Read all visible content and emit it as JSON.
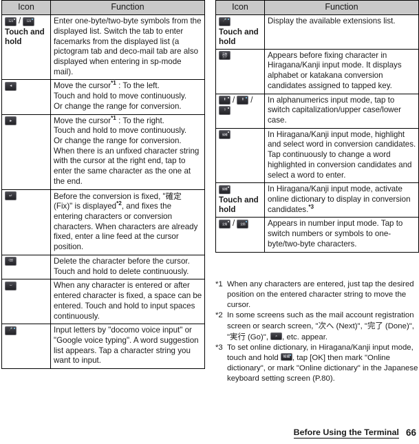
{
  "document": {
    "footer": {
      "section_title": "Before Using the Terminal",
      "page_number": "66"
    }
  },
  "left_table": {
    "headers": {
      "icon": "Icon",
      "function": "Function"
    },
    "rows": [
      {
        "icon_note": "Touch and hold",
        "icon_keys": [
          "123-one-byte-symbol-key",
          "123-two-byte-symbol-key"
        ],
        "function": "Enter one-byte/two-byte symbols from the displayed list. Switch the tab to enter facemarks from the displayed list (a pictogram tab and deco-mail tab are also displayed when entering in sp-mode mail)."
      },
      {
        "icon_note": "",
        "icon_keys": [
          "cursor-left-key"
        ],
        "function_parts": [
          {
            "text": "Move the cursor"
          },
          {
            "sup": "*1"
          },
          {
            "text": " : To the left."
          },
          {
            "br": true
          },
          {
            "text": "Touch and hold to move continuously."
          },
          {
            "br": true
          },
          {
            "text": "Or change the range for conversion."
          }
        ]
      },
      {
        "icon_note": "",
        "icon_keys": [
          "cursor-right-key"
        ],
        "function_parts": [
          {
            "text": "Move the cursor"
          },
          {
            "sup": "*1"
          },
          {
            "text": " : To the right."
          },
          {
            "br": true
          },
          {
            "text": "Touch and hold to move continuously."
          },
          {
            "br": true
          },
          {
            "text": "Or change the range for conversion."
          },
          {
            "br": true
          },
          {
            "text": "When there is an unfixed character string with the cursor at the right end, tap to enter the same character as the one at the end."
          }
        ]
      },
      {
        "icon_note": "",
        "icon_keys": [
          "enter-key"
        ],
        "function_parts": [
          {
            "text": "Before the conversion is fixed, \""
          },
          {
            "jp": "確定"
          },
          {
            "text": " (Fix)\" is displayed"
          },
          {
            "sup": "*2"
          },
          {
            "text": ", and fixes the entering characters or conversion characters. When characters are already fixed, enter a line feed at the cursor position."
          }
        ]
      },
      {
        "icon_note": "",
        "icon_keys": [
          "backspace-key"
        ],
        "function": "Delete the character before the cursor. Touch and hold to delete continuously."
      },
      {
        "icon_note": "",
        "icon_keys": [
          "space-key"
        ],
        "function": "When any character is entered or after entered character is fixed, a space can be entered. Touch and hold to input spaces continuously."
      },
      {
        "icon_note": "",
        "icon_keys": [
          "microphone-voice-input-key"
        ],
        "function": "Input letters by \"docomo voice input\" or \"Google voice typing\". A word suggestion list appears. Tap a character string you want to input."
      }
    ]
  },
  "right_table": {
    "headers": {
      "icon": "Icon",
      "function": "Function"
    },
    "rows": [
      {
        "icon_note": "Touch and hold",
        "icon_keys": [
          "microphone-voice-input-key"
        ],
        "function": "Display the available extensions list."
      },
      {
        "icon_note": "",
        "icon_keys": [
          "katakana-conversion-key"
        ],
        "function": "Appears before fixing character in Hiragana/Kanji input mode. It displays alphabet or katakana conversion candidates assigned to tapped key."
      },
      {
        "icon_note": "",
        "icon_keys": [
          "shift-lowercase-key",
          "shift-uppercase-key",
          "caps-lock-key"
        ],
        "function": "In alphanumerics input mode, tap to switch capitalization/upper case/lower case."
      },
      {
        "icon_note": "",
        "icon_keys": [
          "conversion-candidate-key"
        ],
        "function": "In Hiragana/Kanji input mode, highlight and select word in conversion candidates. Tap continuously to change a word highlighted in conversion candidates and select a word to enter."
      },
      {
        "icon_note": "Touch and hold",
        "icon_keys": [
          "conversion-candidate-key"
        ],
        "function_parts": [
          {
            "text": "In Hiragana/Kanji input mode, activate online dictionary to display in conversion candidates."
          },
          {
            "sup": "*3"
          }
        ]
      },
      {
        "icon_note": "",
        "icon_keys": [
          "full-width-key-a",
          "full-width-key-b"
        ],
        "function": "Appears in number input mode. Tap to switch numbers or symbols to one-byte/two-byte characters."
      }
    ]
  },
  "footnotes": [
    {
      "mark": "*1",
      "parts": [
        {
          "text": "When any characters are entered, just tap the desired position on the entered character string to move the cursor."
        }
      ]
    },
    {
      "mark": "*2",
      "parts": [
        {
          "text": "In some screens such as the mail account registration screen or search screen, \""
        },
        {
          "jp": "次へ"
        },
        {
          "text": " (Next)\", \""
        },
        {
          "jp": "完了"
        },
        {
          "text": " (Done)\", \""
        },
        {
          "jp": "実行"
        },
        {
          "text": " (Go)\", "
        },
        {
          "key": "search-magnifier-key"
        },
        {
          "text": ", etc. appear."
        }
      ]
    },
    {
      "mark": "*3",
      "parts": [
        {
          "text": "To set online dictionary, in Hiragana/Kanji input mode, touch and hold "
        },
        {
          "key": "conversion-candidate-key"
        },
        {
          "text": ", tap [OK] then mark \"Online dictionary\", or mark \"Online dictionary\" in the Japanese keyboard setting screen (P.80)."
        }
      ]
    }
  ]
}
